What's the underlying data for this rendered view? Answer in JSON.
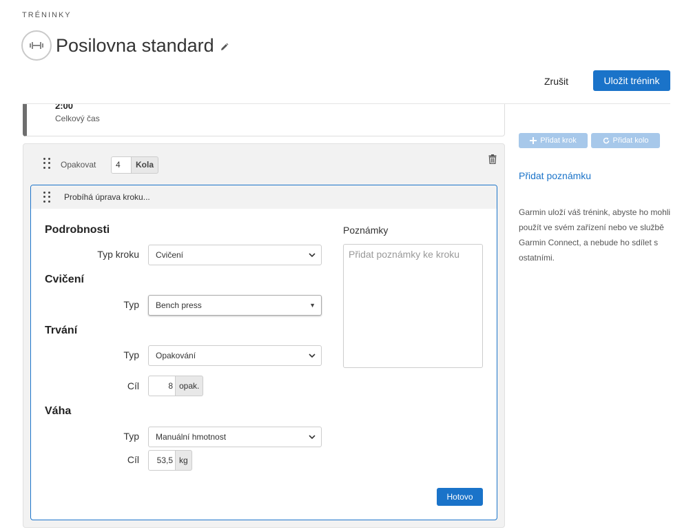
{
  "breadcrumb": "TRÉNINKY",
  "workout": {
    "title": "Posilovna standard",
    "icon": "dumbbell-icon"
  },
  "actions": {
    "cancel_label": "Zrušit",
    "save_label": "Uložit trénink"
  },
  "previous_step": {
    "value": "2:00",
    "label": "Celkový čas"
  },
  "repeat": {
    "label": "Opakovat",
    "count": "4",
    "unit": "Kola"
  },
  "step": {
    "header": "Probíhá úprava kroku...",
    "details": {
      "title": "Podrobnosti",
      "step_type_label": "Typ kroku",
      "step_type_value": "Cvičení"
    },
    "exercise": {
      "title": "Cvičení",
      "type_label": "Typ",
      "type_value": "Bench press"
    },
    "duration": {
      "title": "Trvání",
      "type_label": "Typ",
      "type_value": "Opakování",
      "target_label": "Cíl",
      "target_value": "8",
      "target_unit": "opak."
    },
    "weight": {
      "title": "Váha",
      "type_label": "Typ",
      "type_value": "Manuální hmotnost",
      "target_label": "Cíl",
      "target_value": "53,5",
      "target_unit": "kg"
    },
    "notes": {
      "label": "Poznámky",
      "placeholder": "Přidat poznámky ke kroku"
    },
    "done_label": "Hotovo"
  },
  "sidebar": {
    "add_step_label": "Přidat krok",
    "add_round_label": "Přidat kolo",
    "add_note_label": "Přidat poznámku",
    "info": "Garmin uloží váš trénink, abyste ho mohli použít ve svém zařízení nebo ve službě Garmin Connect, a nebude ho sdílet s ostatními."
  },
  "colors": {
    "accent": "#1a73c9",
    "disabled_button": "#a7c8ea"
  }
}
